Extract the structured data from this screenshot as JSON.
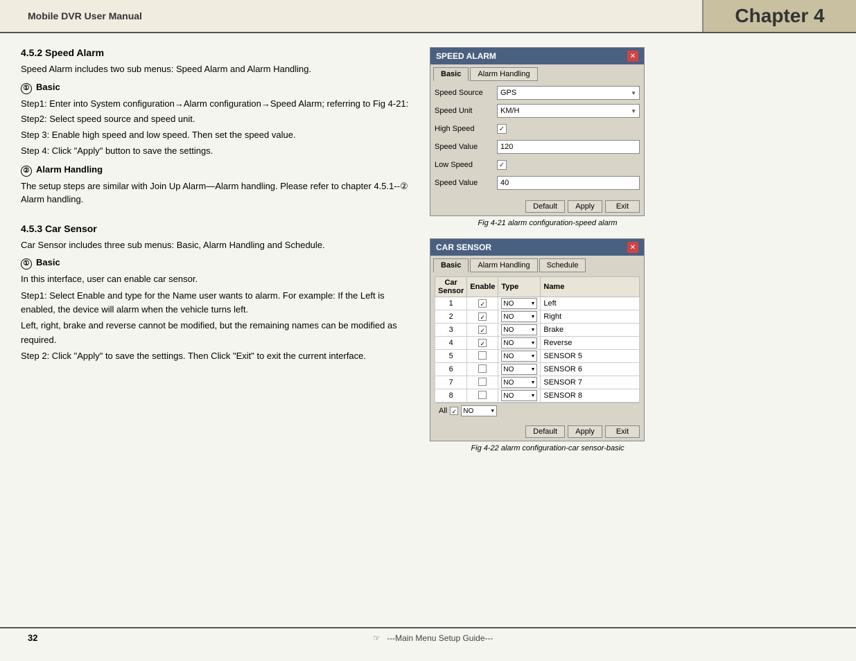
{
  "header": {
    "title": "Mobile DVR User Manual",
    "chapter": "Chapter 4"
  },
  "footer": {
    "page_number": "32",
    "center_text": "---Main Menu Setup Guide---"
  },
  "section_452": {
    "title": "4.5.2  Speed Alarm",
    "intro": "Speed Alarm includes two sub menus: Speed Alarm and Alarm Handling.",
    "sub1_label": "Basic",
    "sub1_num": "①",
    "steps": [
      "Step1: Enter into System configuration→Alarm configuration→Speed Alarm; referring to Fig 4-21:",
      "Step2: Select speed source and speed unit.",
      "Step 3: Enable high speed and low speed. Then set the speed value.",
      "Step 4: Click \"Apply\" button to save the settings."
    ],
    "sub2_label": "Alarm Handling",
    "sub2_num": "②",
    "alarm_handling_text": "The setup steps are similar with Join Up Alarm—Alarm handling. Please refer to chapter 4.5.1--② Alarm handling."
  },
  "section_453": {
    "title": "4.5.3  Car Sensor",
    "intro": "Car Sensor includes three sub menus: Basic, Alarm Handling and Schedule.",
    "sub1_label": "Basic",
    "sub1_num": "①",
    "basic_intro": "In this interface, user can enable car sensor.",
    "steps": [
      "Step1: Select Enable and type for the Name user wants to alarm. For example: If the Left is enabled, the device will alarm when the vehicle turns left.",
      "Left, right, brake and reverse cannot be modified, but the remaining names can be modified as required.",
      "Step 2: Click \"Apply\" to save the settings. Then Click \"Exit\" to exit the current interface."
    ]
  },
  "speed_alarm_dialog": {
    "title": "SPEED ALARM",
    "tabs": [
      "Basic",
      "Alarm Handling"
    ],
    "active_tab": "Basic",
    "rows": [
      {
        "label": "Speed Source",
        "value": "GPS",
        "type": "select"
      },
      {
        "label": "Speed Unit",
        "value": "KM/H",
        "type": "select"
      },
      {
        "label": "High Speed",
        "value": "",
        "type": "checkbox",
        "checked": true
      },
      {
        "label": "Speed Value",
        "value": "120",
        "type": "text"
      },
      {
        "label": "Low Speed",
        "value": "",
        "type": "checkbox",
        "checked": true
      },
      {
        "label": "Speed Value",
        "value": "40",
        "type": "text"
      }
    ],
    "buttons": [
      "Default",
      "Apply",
      "Exit"
    ],
    "caption": "Fig 4-21 alarm configuration-speed alarm"
  },
  "car_sensor_dialog": {
    "title": "CAR SENSOR",
    "tabs": [
      "Basic",
      "Alarm Handling",
      "Schedule"
    ],
    "active_tab": "Basic",
    "columns": [
      "Car Sensor",
      "Enable",
      "Type",
      "Name"
    ],
    "rows": [
      {
        "num": "1",
        "enabled": true,
        "type": "NO",
        "name": "Left"
      },
      {
        "num": "2",
        "enabled": true,
        "type": "NO",
        "name": "Right"
      },
      {
        "num": "3",
        "enabled": true,
        "type": "NO",
        "name": "Brake"
      },
      {
        "num": "4",
        "enabled": true,
        "type": "NO",
        "name": "Reverse"
      },
      {
        "num": "5",
        "enabled": false,
        "type": "NO",
        "name": "SENSOR 5"
      },
      {
        "num": "6",
        "enabled": false,
        "type": "NO",
        "name": "SENSOR 6"
      },
      {
        "num": "7",
        "enabled": false,
        "type": "NO",
        "name": "SENSOR 7"
      },
      {
        "num": "8",
        "enabled": false,
        "type": "NO",
        "name": "SENSOR 8"
      }
    ],
    "all_row_label": "All",
    "all_checked": true,
    "all_type": "NO",
    "buttons": [
      "Default",
      "Apply",
      "Exit"
    ],
    "caption": "Fig 4-22 alarm configuration-car sensor-basic"
  }
}
